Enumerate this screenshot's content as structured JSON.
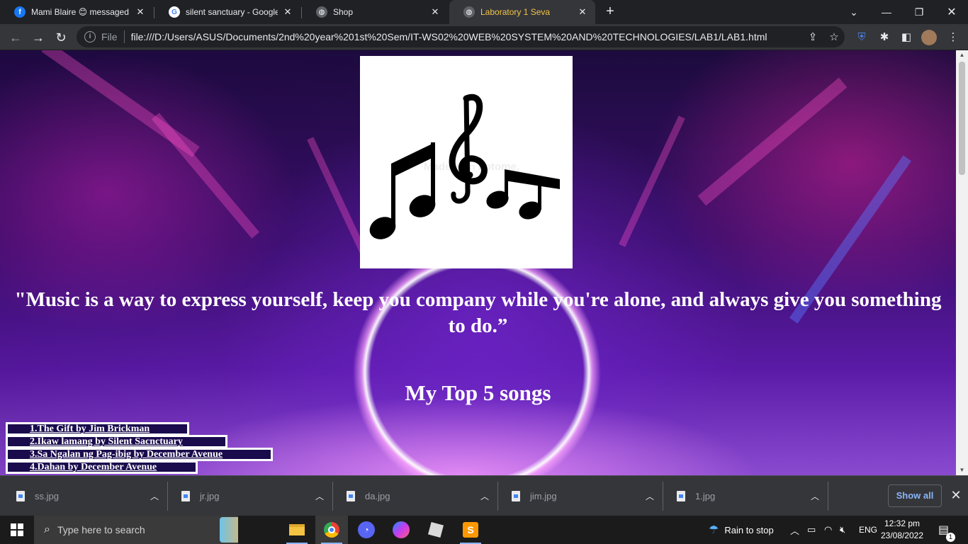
{
  "tabs": [
    {
      "title": "Mami Blaire 😊 messaged ...",
      "icon": "facebook-icon",
      "color": "#1877f2"
    },
    {
      "title": "silent sanctuary - Google S",
      "icon": "google-icon",
      "color": "#ffffff"
    },
    {
      "title": "Shop",
      "icon": "globe-icon",
      "color": "#9aa0a6"
    },
    {
      "title": "Laboratory 1 Seva",
      "icon": "globe-icon",
      "color": "#9aa0a6"
    }
  ],
  "address": {
    "scheme": "File",
    "url": "file:///D:/Users/ASUS/Documents/2nd%20year%201st%20Sem/IT-WS02%20WEB%20SYSTEM%20AND%20TECHNOLOGIES/LAB1/LAB1.html"
  },
  "page": {
    "watermark": "Made with Fotome.",
    "quote": "\"Music is a way to express yourself, keep you company while you're alone, and always give you something to do.”",
    "heading": "My Top 5 songs",
    "songs": [
      "1.The Gift by Jim Brickman",
      "2.Ikaw lamang by Silent Sacnctuary",
      "3.Sa Ngalan ng Pag-ibig by December Avenue",
      "4.Dahan by December Avenue"
    ]
  },
  "downloads": {
    "files": [
      "ss.jpg",
      "jr.jpg",
      "da.jpg",
      "jim.jpg",
      "1.jpg"
    ],
    "show_all": "Show all"
  },
  "taskbar": {
    "search_placeholder": "Type here to search",
    "weather": "Rain to stop",
    "language": "ENG",
    "time": "12:32 pm",
    "date": "23/08/2022",
    "notification_count": "1"
  },
  "colors": {
    "accent_tab": "#f1c44a",
    "link_blue": "#8ab4f8"
  }
}
